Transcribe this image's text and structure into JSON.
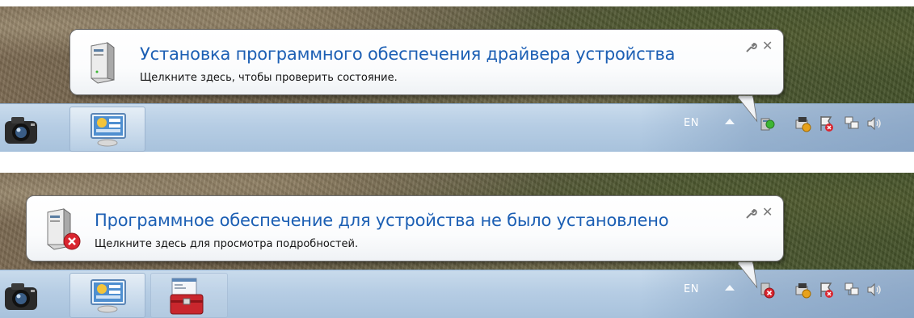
{
  "notifications": [
    {
      "title": "Установка программного обеспечения драйвера устройства",
      "subtitle": "Щелкните здесь, чтобы проверить состояние.",
      "icon": "device-tower-icon",
      "status": "installing"
    },
    {
      "title": "Программное обеспечение для устройства не было установлено",
      "subtitle": "Щелкните здесь для просмотра подробностей.",
      "icon": "device-tower-error-icon",
      "status": "failed"
    }
  ],
  "taskbar": {
    "language": "EN",
    "pinned": [
      "camera-app-icon",
      "control-panel-icon"
    ],
    "running_second": [
      "camera-app-icon",
      "control-panel-icon",
      "toolbox-icon"
    ],
    "tray_icons": [
      "show-hidden-icons-arrow",
      "device-status-icon",
      "network-warning-icon",
      "action-center-icon",
      "network-icon",
      "volume-icon"
    ]
  },
  "colors": {
    "title_blue": "#1c5fb4",
    "taskbar": "#b6cde4",
    "error_red": "#d9252f",
    "ok_green": "#3db634"
  }
}
